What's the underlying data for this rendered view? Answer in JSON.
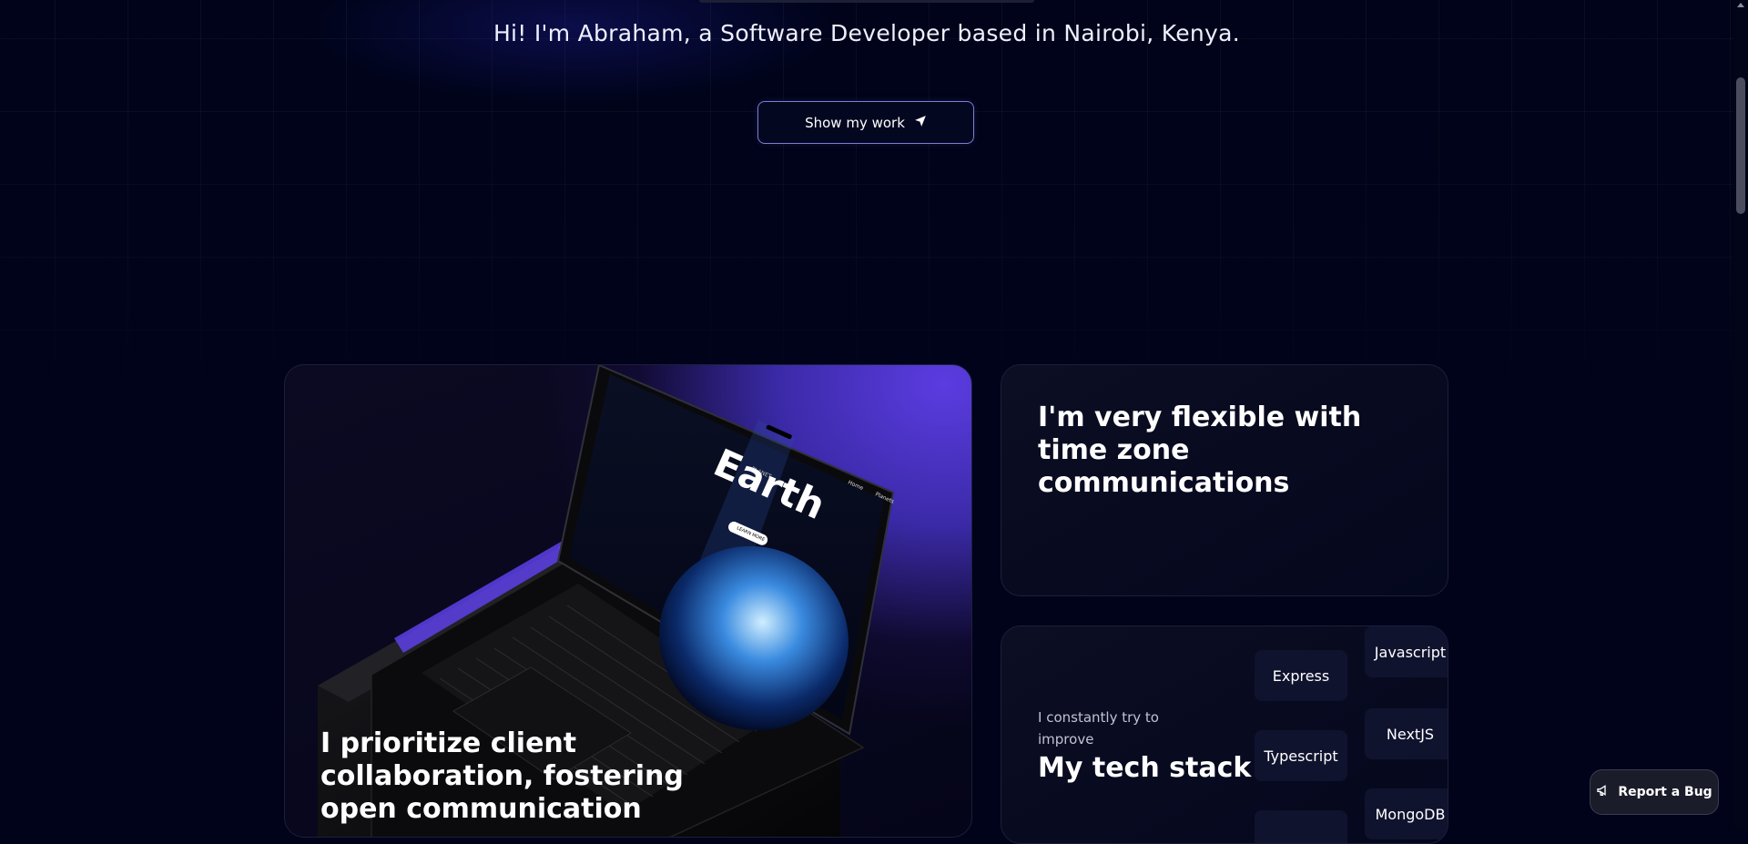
{
  "hero": {
    "intro": "Hi! I'm Abraham, a Software Developer based in Nairobi, Kenya.",
    "cta_label": "Show my work"
  },
  "cards": {
    "collab_title": "I prioritize client collaboration, fostering open communication",
    "timezone_title": "I'm very flexible with time zone communications",
    "tech": {
      "subtitle": "I constantly try to improve",
      "title": "My tech stack",
      "left_column": [
        "Express",
        "Typescript"
      ],
      "right_column": [
        "Javascript",
        "NextJS",
        "MongoDB"
      ]
    }
  },
  "laptop_screen": {
    "kicker": "PLANET",
    "heading": "Earth",
    "nav": [
      "Home",
      "Planets"
    ],
    "button": "LEARN MORE"
  },
  "report_bug": {
    "label": "Report a Bug"
  },
  "colors": {
    "background": "#000319",
    "accent": "#5b3ce0",
    "button_border": "#7d7dd9"
  }
}
